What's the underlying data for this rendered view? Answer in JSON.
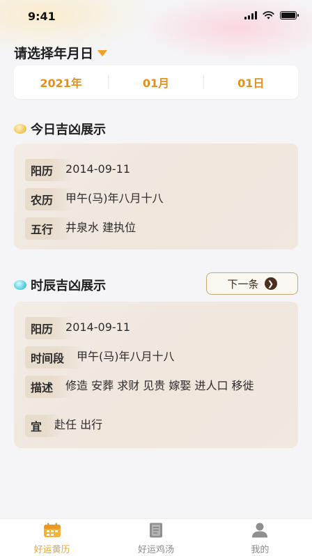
{
  "status_bar": {
    "time": "9:41"
  },
  "date_select": {
    "title": "请选择年月日",
    "year": "2021年",
    "month": "01月",
    "day": "01日"
  },
  "today_section": {
    "title": "今日吉凶展示",
    "rows": [
      {
        "label": "阳历",
        "value": "2014-09-11"
      },
      {
        "label": "农历",
        "value": "甲午(马)年八月十八"
      },
      {
        "label": "五行",
        "value": "井泉水 建执位"
      }
    ]
  },
  "hour_section": {
    "title": "时辰吉凶展示",
    "next_label": "下一条",
    "rows": [
      {
        "label": "阳历",
        "value": "2014-09-11"
      },
      {
        "label": "时间段",
        "value": "甲午(马)年八月十八"
      },
      {
        "label": "描述",
        "value": "修造 安葬 求财 见贵 嫁娶 进人口 移徙"
      },
      {
        "label": "宜",
        "value": "赴任 出行"
      }
    ]
  },
  "tabbar": {
    "items": [
      {
        "label": "好运黄历",
        "icon": "calendar-icon",
        "active": true
      },
      {
        "label": "好运鸡汤",
        "icon": "book-icon",
        "active": false
      },
      {
        "label": "我的",
        "icon": "user-icon",
        "active": false
      }
    ],
    "active_color": "#e6a531",
    "inactive_color": "#8a8a8a"
  },
  "colors": {
    "accent": "#e2901f",
    "card_bg": "#f1e9e0",
    "next_button_border": "#c9a57a"
  }
}
